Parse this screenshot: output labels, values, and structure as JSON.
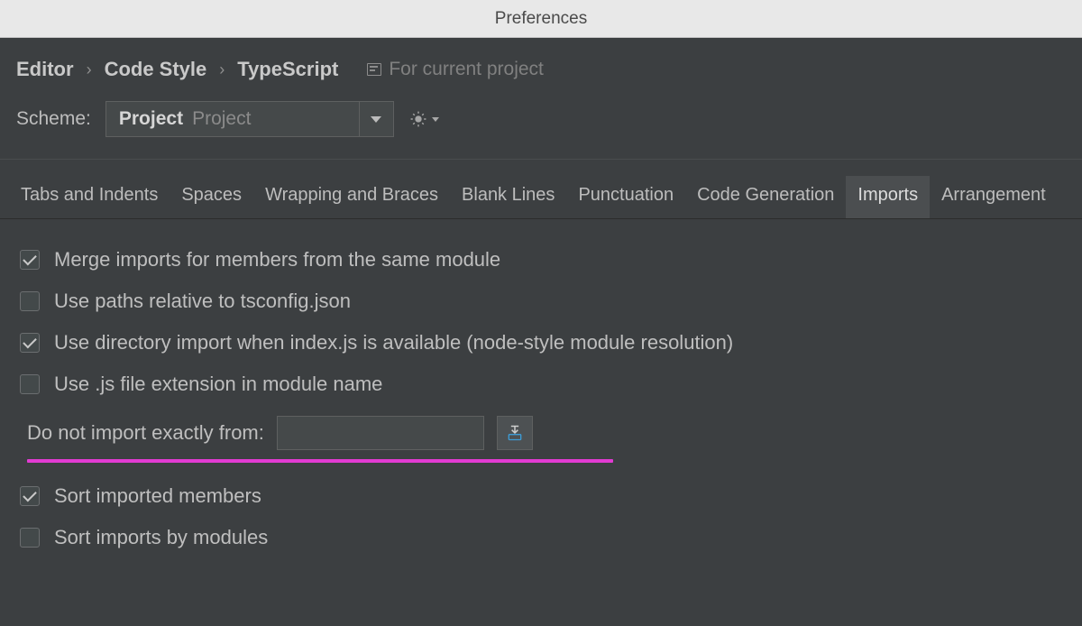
{
  "window": {
    "title": "Preferences"
  },
  "breadcrumb": {
    "items": [
      "Editor",
      "Code Style",
      "TypeScript"
    ],
    "scope_label": "For current project"
  },
  "scheme": {
    "label": "Scheme:",
    "value_bold": "Project",
    "value_muted": "Project"
  },
  "tabs": [
    {
      "label": "Tabs and Indents",
      "active": false
    },
    {
      "label": "Spaces",
      "active": false
    },
    {
      "label": "Wrapping and Braces",
      "active": false
    },
    {
      "label": "Blank Lines",
      "active": false
    },
    {
      "label": "Punctuation",
      "active": false
    },
    {
      "label": "Code Generation",
      "active": false
    },
    {
      "label": "Imports",
      "active": true
    },
    {
      "label": "Arrangement",
      "active": false
    }
  ],
  "options": {
    "merge_imports": {
      "label": "Merge imports for members from the same module",
      "checked": true
    },
    "use_paths_relative": {
      "label": "Use paths relative to tsconfig.json",
      "checked": false
    },
    "use_directory_import": {
      "label": "Use directory import when index.js is available (node-style module resolution)",
      "checked": true
    },
    "use_js_extension": {
      "label": "Use .js file extension in module name",
      "checked": false
    },
    "do_not_import": {
      "label": "Do not import exactly from:",
      "value": ""
    },
    "sort_imported_members": {
      "label": "Sort imported members",
      "checked": true
    },
    "sort_imports_by_modules": {
      "label": "Sort imports by modules",
      "checked": false
    }
  }
}
